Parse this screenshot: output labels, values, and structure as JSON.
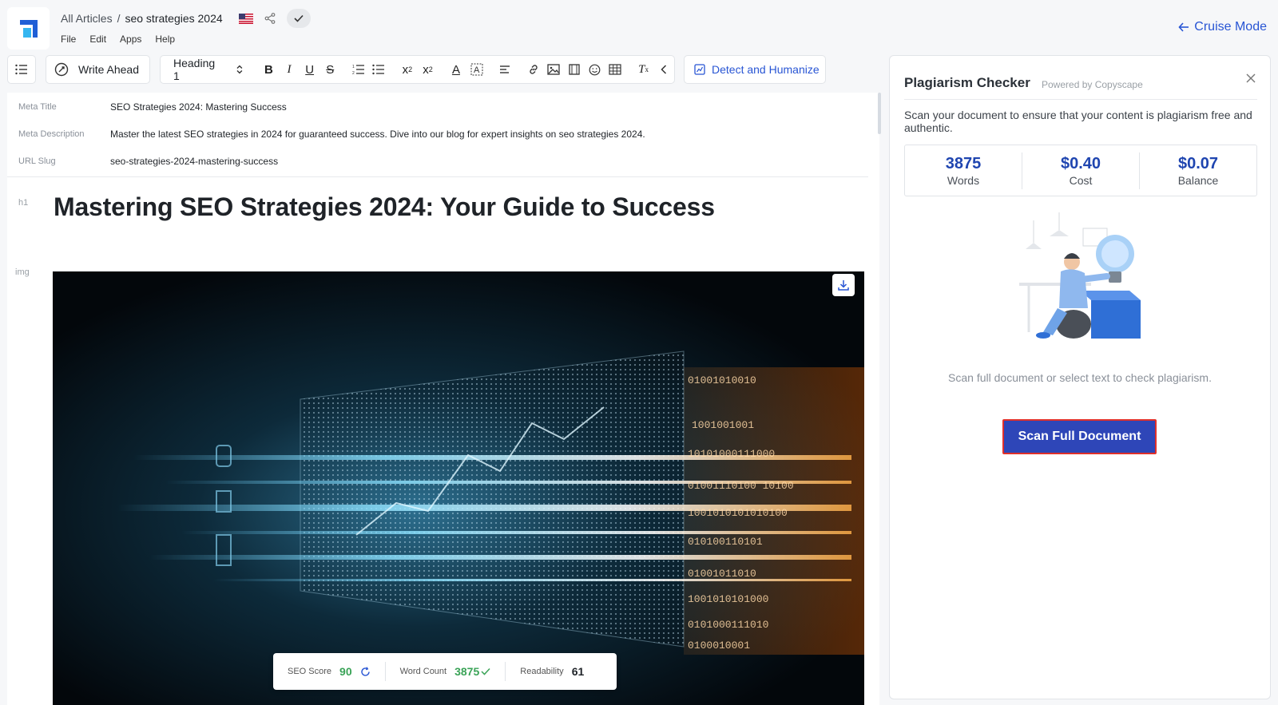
{
  "header": {
    "breadcrumb_root": "All Articles",
    "breadcrumb_sep": "/",
    "breadcrumb_current": "seo strategies 2024",
    "menu": [
      "File",
      "Edit",
      "Apps",
      "Help"
    ],
    "cruise_mode": "Cruise Mode"
  },
  "toolbar": {
    "write_ahead": "Write Ahead",
    "heading_select": "Heading 1",
    "detect_humanize": "Detect and Humanize"
  },
  "meta": {
    "title_label": "Meta Title",
    "title_value": "SEO Strategies 2024: Mastering Success",
    "description_label": "Meta Description",
    "description_value": "Master the latest SEO strategies in 2024 for guaranteed success. Dive into our blog for expert insights on seo strategies 2024.",
    "slug_label": "URL Slug",
    "slug_value": "seo-strategies-2024-mastering-success"
  },
  "article": {
    "h1_tag": "h1",
    "h1_text": "Mastering SEO Strategies 2024: Your Guide to Success",
    "img_tag": "img"
  },
  "status_bar": {
    "seo_label": "SEO Score",
    "seo_value": "90",
    "word_label": "Word Count",
    "word_value": "3875",
    "readability_label": "Readability",
    "readability_value": "61"
  },
  "panel": {
    "title": "Plagiarism Checker",
    "powered_by": "Powered by Copyscape",
    "description": "Scan your document to ensure that your content is plagiarism free and authentic.",
    "stats": [
      {
        "value": "3875",
        "label": "Words"
      },
      {
        "value": "$0.40",
        "label": "Cost"
      },
      {
        "value": "$0.07",
        "label": "Balance"
      }
    ],
    "hint": "Scan full document or select text to check plagiarism.",
    "scan_button": "Scan Full Document"
  },
  "colors": {
    "accent": "#2855d4",
    "button": "#2e46b8",
    "button_border": "#e0302b",
    "score_green": "#3aa357"
  }
}
